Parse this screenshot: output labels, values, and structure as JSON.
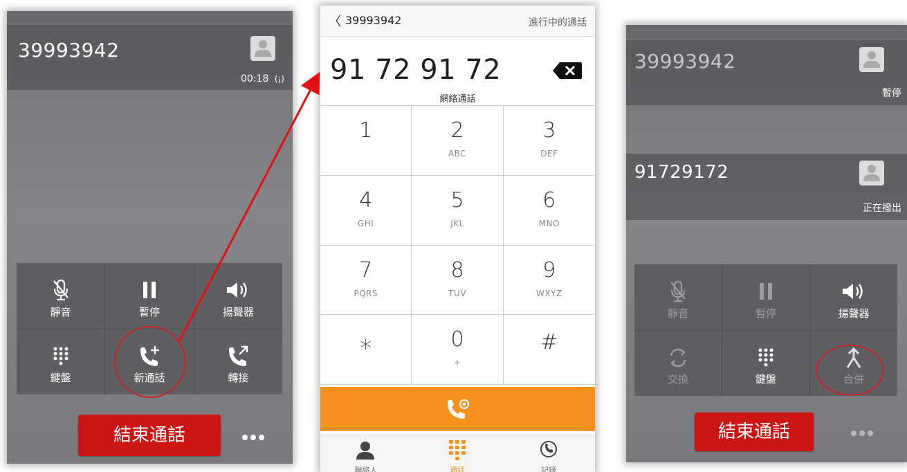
{
  "colors": {
    "end_call": "#cc1515",
    "accent_orange": "#f5921e",
    "annotation_red": "#e01010"
  },
  "left": {
    "caller_number": "39993942",
    "timer": "00:18",
    "signal_glyph": "(¡)",
    "buttons": [
      {
        "label": "靜音",
        "icon": "mic-off-icon"
      },
      {
        "label": "暫停",
        "icon": "pause-icon"
      },
      {
        "label": "揚聲器",
        "icon": "speaker-icon"
      },
      {
        "label": "鍵盤",
        "icon": "keypad-icon"
      },
      {
        "label": "新通話",
        "icon": "add-call-icon"
      },
      {
        "label": "轉接",
        "icon": "transfer-icon"
      }
    ],
    "end_call_label": "結束通話"
  },
  "dialer": {
    "back_number": "39993942",
    "header_right": "進行中的通話",
    "entered_number": "91 72 91 72",
    "subtitle": "網絡通話",
    "keys": [
      {
        "digit": "1",
        "letters": ""
      },
      {
        "digit": "2",
        "letters": "ABC"
      },
      {
        "digit": "3",
        "letters": "DEF"
      },
      {
        "digit": "4",
        "letters": "GHI"
      },
      {
        "digit": "5",
        "letters": "JKL"
      },
      {
        "digit": "6",
        "letters": "MNO"
      },
      {
        "digit": "7",
        "letters": "PQRS"
      },
      {
        "digit": "8",
        "letters": "TUV"
      },
      {
        "digit": "9",
        "letters": "WXYZ"
      },
      {
        "digit": "∗",
        "letters": ""
      },
      {
        "digit": "0",
        "letters": "+"
      },
      {
        "digit": "#",
        "letters": ""
      }
    ],
    "tabs": [
      {
        "label": "聯絡人",
        "icon": "contacts-icon"
      },
      {
        "label": "通話",
        "icon": "dialpad-icon"
      },
      {
        "label": "記錄",
        "icon": "history-icon"
      }
    ]
  },
  "right": {
    "call1_number": "39993942",
    "call1_status": "暫停",
    "call2_number": "91729172",
    "call2_status": "正在撥出",
    "buttons": [
      {
        "label": "靜音",
        "icon": "mic-off-icon",
        "enabled": false
      },
      {
        "label": "暫停",
        "icon": "pause-icon",
        "enabled": false
      },
      {
        "label": "揚聲器",
        "icon": "speaker-icon",
        "enabled": true
      },
      {
        "label": "交換",
        "icon": "swap-icon",
        "enabled": false
      },
      {
        "label": "鍵盤",
        "icon": "keypad-icon",
        "enabled": true
      },
      {
        "label": "合併",
        "icon": "merge-icon",
        "enabled": false
      }
    ],
    "end_call_label": "結束通話"
  }
}
